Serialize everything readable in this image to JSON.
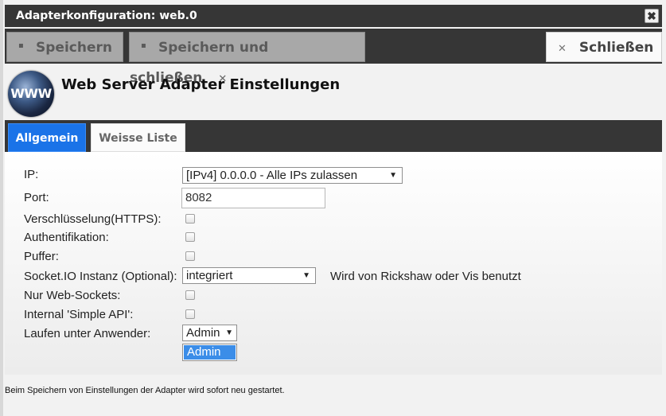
{
  "window": {
    "title": "Adapterkonfiguration: web.0",
    "close_glyph": "✖"
  },
  "toolbar": {
    "save_label": "Speichern",
    "save_close_label": "Speichern und schließen",
    "close_label": "Schließen"
  },
  "header": {
    "logo_text": "WWW",
    "title": "Web Server Adapter Einstellungen"
  },
  "tabs": [
    {
      "label": "Allgemein",
      "active": true
    },
    {
      "label": "Weisse Liste",
      "active": false
    }
  ],
  "form": {
    "ip": {
      "label": "IP:",
      "value": "[IPv4] 0.0.0.0 - Alle IPs zulassen"
    },
    "port": {
      "label": "Port:",
      "value": "8082"
    },
    "https": {
      "label": "Verschlüsselung(HTTPS):",
      "checked": false
    },
    "auth": {
      "label": "Authentifikation:",
      "checked": false
    },
    "cache": {
      "label": "Puffer:",
      "checked": false
    },
    "socketio": {
      "label": "Socket.IO Instanz (Optional):",
      "value": "integriert",
      "hint": "Wird von Rickshaw oder Vis benutzt"
    },
    "websockets": {
      "label": "Nur Web-Sockets:",
      "checked": false
    },
    "simpleapi": {
      "label": "Internal 'Simple API':",
      "checked": false
    },
    "user": {
      "label": "Laufen unter Anwender:",
      "value": "Admin",
      "options": [
        "Admin"
      ]
    }
  },
  "footer": {
    "note": "Beim Speichern von Einstellungen der Adapter wird sofort neu gestartet."
  },
  "colors": {
    "active_tab": "#1a73e8",
    "titlebar": "#363636",
    "dropdown_highlight": "#3b8de8"
  }
}
